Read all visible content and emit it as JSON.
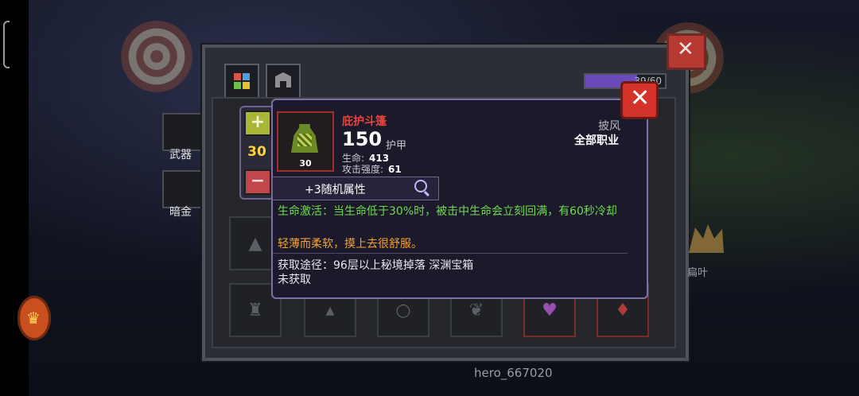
{
  "header": {
    "capacity": "39/60",
    "capacity_fraction": 0.65
  },
  "sidebar": {
    "weapon_label": "武器",
    "hidden_gold_label": "暗金"
  },
  "background": {
    "npc_label": "扁叶",
    "player_name": "hero_667020"
  },
  "stepper": {
    "plus": "+",
    "value": "30",
    "minus": "−"
  },
  "item": {
    "name": "庇护斗篷",
    "level": "30",
    "armor_value": "150",
    "armor_label": "护甲",
    "stats": [
      {
        "label": "生命:",
        "value": "413"
      },
      {
        "label": "攻击强度:",
        "value": "61"
      }
    ],
    "slot_type": "披风",
    "class_requirement": "全部职业",
    "random_attributes": "+3随机属性",
    "effect": "生命激活：当生命低于30%时，被击中生命会立刻回满，有60秒冷却",
    "flavor": "轻薄而柔软，摸上去很舒服。",
    "source": "获取途径：96层以上秘境掉落 深渊宝箱",
    "obtained_status": "未获取"
  },
  "colors": {
    "name_red": "#e8453c",
    "effect_green": "#6fdb50",
    "flavor_orange": "#f0a234",
    "stepper_value": "#ffd43b"
  },
  "icons": [
    "close-icon",
    "plus-icon",
    "minus-icon",
    "magnifier-icon",
    "cloak-icon",
    "inventory-grid-icon",
    "helmet-icon"
  ]
}
